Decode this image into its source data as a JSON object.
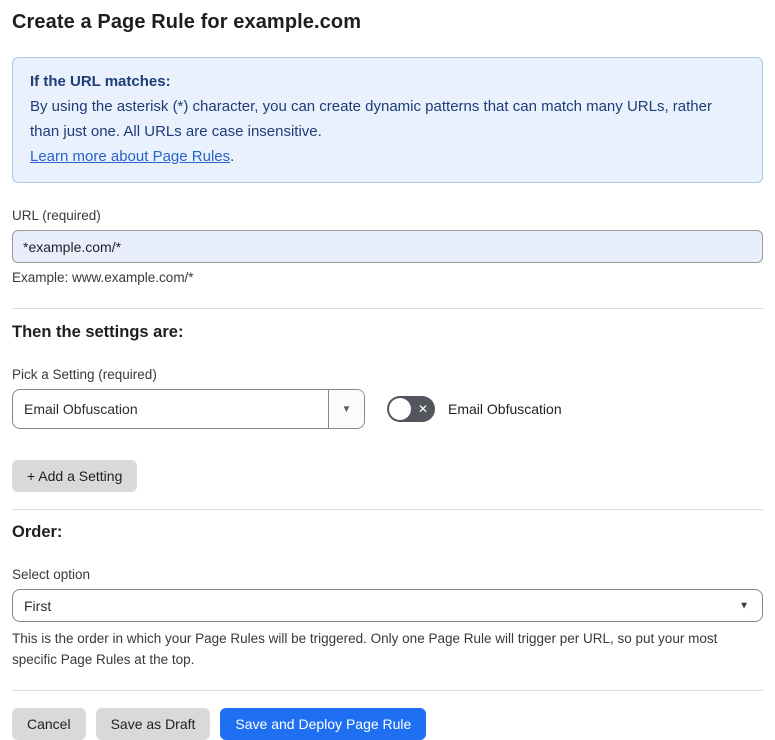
{
  "page": {
    "title": "Create a Page Rule for example.com"
  },
  "info_box": {
    "heading": "If the URL matches:",
    "body": "By using the asterisk (*) character, you can create dynamic patterns that can match many URLs, rather than just one. All URLs are case insensitive.",
    "link": "Learn more about Page Rules",
    "link_suffix": "."
  },
  "url_field": {
    "label": "URL (required)",
    "value": "*example.com/*",
    "helper": "Example: www.example.com/*"
  },
  "settings_section": {
    "heading": "Then the settings are:",
    "picker_label": "Pick a Setting (required)",
    "picker_value": "Email Obfuscation",
    "picker_arrow": "▼",
    "toggle_label": "Email Obfuscation",
    "toggle_state": "off",
    "toggle_glyph": "✕",
    "add_button": "+ Add a Setting"
  },
  "order_section": {
    "heading": "Order:",
    "select_label": "Select option",
    "select_value": "First",
    "select_arrow": "▼",
    "helper": "This is the order in which your Page Rules will be triggered. Only one Page Rule will trigger per URL, so put your most specific Page Rules at the top."
  },
  "footer": {
    "cancel": "Cancel",
    "save_draft": "Save as Draft",
    "save_deploy": "Save and Deploy Page Rule"
  },
  "colors": {
    "accent_blue": "#1f6ff2",
    "info_bg": "#e9f1fc",
    "info_border": "#a9c8ee",
    "info_text": "#1e3c78",
    "link_blue": "#2a62c9",
    "input_bg": "#e8eefc",
    "toggle_off_bg": "#53565c",
    "button_gray": "#d9d9d9"
  }
}
